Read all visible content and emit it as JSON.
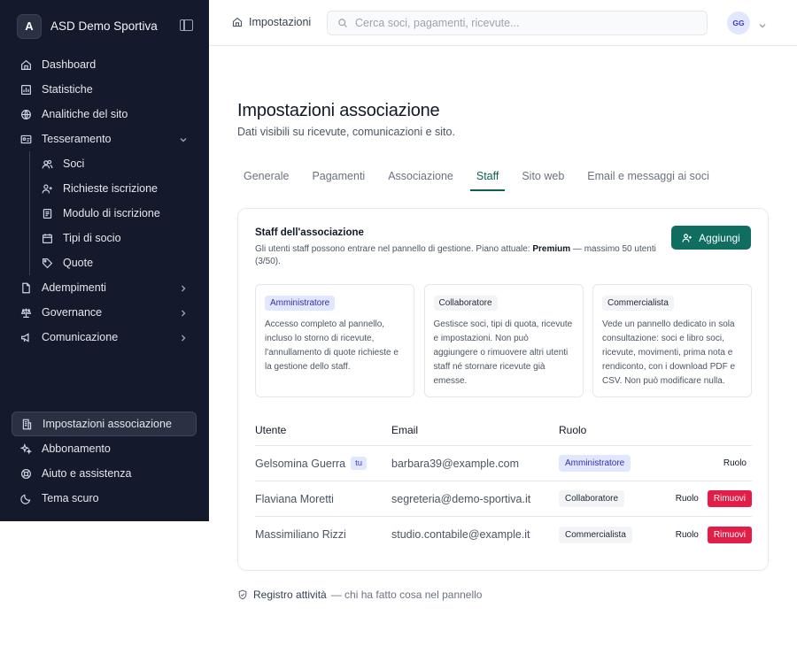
{
  "brand": {
    "logo_letter": "A",
    "name": "ASD Demo Sportiva"
  },
  "sidebar": {
    "items": [
      {
        "label": "Dashboard",
        "icon": "home-icon"
      },
      {
        "label": "Statistiche",
        "icon": "chart-icon"
      },
      {
        "label": "Analitiche del sito",
        "icon": "globe-icon"
      },
      {
        "label": "Tesseramento",
        "icon": "id-card-icon",
        "expanded": true
      }
    ],
    "subitems": [
      {
        "label": "Soci",
        "icon": "users-icon"
      },
      {
        "label": "Richieste iscrizione",
        "icon": "user-plus-icon"
      },
      {
        "label": "Modulo di iscrizione",
        "icon": "form-icon"
      },
      {
        "label": "Tipi di socio",
        "icon": "calendar-icon"
      },
      {
        "label": "Quote",
        "icon": "tag-icon"
      }
    ],
    "groups": [
      {
        "label": "Adempimenti",
        "icon": "document-icon"
      },
      {
        "label": "Governance",
        "icon": "scale-icon"
      },
      {
        "label": "Comunicazione",
        "icon": "megaphone-icon"
      }
    ],
    "bottom": [
      {
        "label": "Impostazioni associazione",
        "icon": "building-icon",
        "active": true
      },
      {
        "label": "Abbonamento",
        "icon": "sparkles-icon"
      },
      {
        "label": "Aiuto e assistenza",
        "icon": "lifebuoy-icon"
      },
      {
        "label": "Tema scuro",
        "icon": "moon-icon"
      }
    ]
  },
  "topbar": {
    "breadcrumb": "Impostazioni",
    "search_placeholder": "Cerca soci, pagamenti, ricevute...",
    "avatar_initials": "GG"
  },
  "main": {
    "title": "Impostazioni associazione",
    "subtitle": "Dati visibili su ricevute, comunicazioni e sito.",
    "tabs": [
      {
        "label": "Generale"
      },
      {
        "label": "Pagamenti"
      },
      {
        "label": "Associazione"
      },
      {
        "label": "Staff",
        "active": true
      },
      {
        "label": "Sito web"
      },
      {
        "label": "Email e messaggi ai soci"
      }
    ]
  },
  "staff": {
    "title": "Staff dell'associazione",
    "desc_prefix": "Gli utenti staff possono entrare nel pannello di gestione. Piano attuale: ",
    "plan": "Premium",
    "desc_suffix": " — massimo 50 utenti (3/50).",
    "add_label": "Aggiungi",
    "roles": [
      {
        "badge": "Amministratore",
        "text": "Accesso completo al pannello, incluso lo storno di ricevute, l'annullamento di quote richieste e la gestione dello staff."
      },
      {
        "badge": "Collaboratore",
        "text": "Gestisce soci, tipi di quota, ricevute e impostazioni. Non può aggiungere o rimuovere altri utenti staff né stornare ricevute già emesse."
      },
      {
        "badge": "Commercialista",
        "text": "Vede un pannello dedicato in sola consultazione: soci e libro soci, ricevute, movimenti, prima nota e rendiconto, con i download PDF e CSV. Non può modificare nulla."
      }
    ],
    "table": {
      "headers": [
        "Utente",
        "Email",
        "Ruolo"
      ],
      "rows": [
        {
          "user": "Gelsomina Guerra",
          "self_tag": "tu",
          "email": "barbara39@example.com",
          "role": "Amministratore",
          "role_action": "Ruolo",
          "remove": ""
        },
        {
          "user": "Flaviana Moretti",
          "self_tag": "",
          "email": "segreteria@demo-sportiva.it",
          "role": "Collaboratore",
          "role_action": "Ruolo",
          "remove": "Rimuovi"
        },
        {
          "user": "Massimiliano Rizzi",
          "self_tag": "",
          "email": "studio.contabile@example.it",
          "role": "Commercialista",
          "role_action": "Ruolo",
          "remove": "Rimuovi"
        }
      ]
    }
  },
  "footer": {
    "link": "Registro attività",
    "desc": "— chi ha fatto cosa nel pannello"
  },
  "colors": {
    "sidebar_bg": "#141a2b",
    "accent": "#0f6e5f",
    "danger": "#e11d48",
    "admin_badge": "#e0e7ff"
  }
}
